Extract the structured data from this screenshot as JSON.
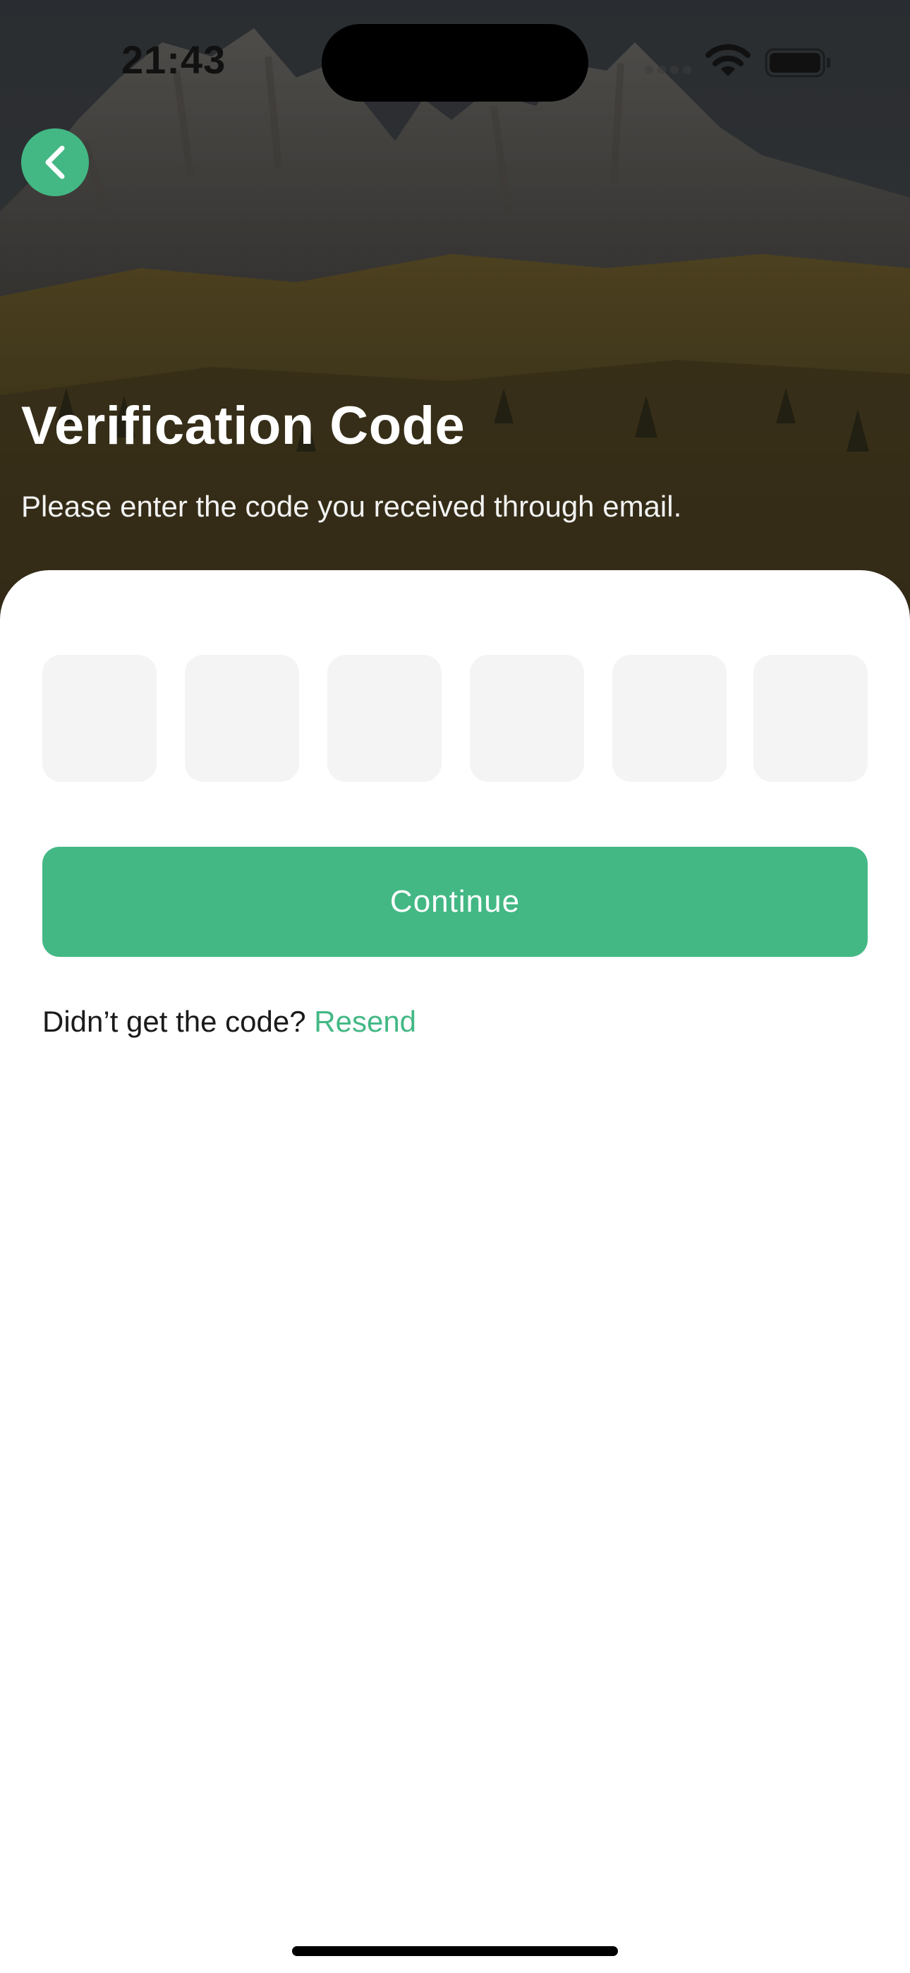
{
  "status_bar": {
    "time": "21:43"
  },
  "header": {
    "back_icon": "chevron-left-icon",
    "title": "Verification Code",
    "subtitle": "Please enter the code you received through email."
  },
  "code_inputs": [
    {
      "value": ""
    },
    {
      "value": ""
    },
    {
      "value": ""
    },
    {
      "value": ""
    },
    {
      "value": ""
    },
    {
      "value": ""
    }
  ],
  "actions": {
    "continue_label": "Continue",
    "resend_prompt": "Didn’t get the code? ",
    "resend_label": "Resend"
  },
  "colors": {
    "accent": "#43b885",
    "input_bg": "#f4f4f4"
  }
}
